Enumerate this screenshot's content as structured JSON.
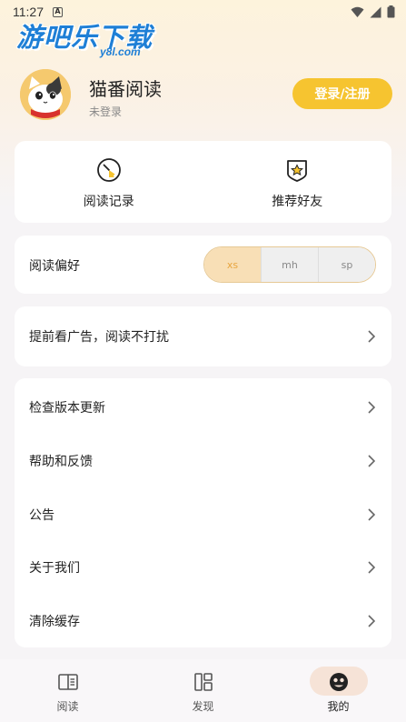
{
  "status_bar": {
    "time": "11:27",
    "a_icon": "A"
  },
  "watermark": {
    "main": "游吧乐下载",
    "sub": "y8l.com"
  },
  "profile": {
    "app_name": "猫番阅读",
    "login_status": "未登录",
    "login_button": "登录/注册"
  },
  "quick_actions": [
    {
      "label": "阅读记录",
      "icon": "clock-icon"
    },
    {
      "label": "推荐好友",
      "icon": "star-badge-icon"
    }
  ],
  "reading_pref": {
    "label": "阅读偏好",
    "options": [
      "xs",
      "mh",
      "sp"
    ],
    "selected": "xs"
  },
  "ad_row": {
    "label": "提前看广告，阅读不打扰"
  },
  "settings_list": [
    {
      "label": "检查版本更新"
    },
    {
      "label": "帮助和反馈"
    },
    {
      "label": "公告"
    },
    {
      "label": "关于我们"
    },
    {
      "label": "清除缓存"
    }
  ],
  "bottom_nav": [
    {
      "label": "阅读",
      "icon": "book-icon"
    },
    {
      "label": "发现",
      "icon": "discover-grid-icon"
    },
    {
      "label": "我的",
      "icon": "profile-icon",
      "active": true
    }
  ],
  "colors": {
    "accent": "#f6c430",
    "segment_active_bg": "#f8dfb6",
    "segment_active_text": "#e8a640",
    "nav_active_pill": "#f6e3d7"
  }
}
